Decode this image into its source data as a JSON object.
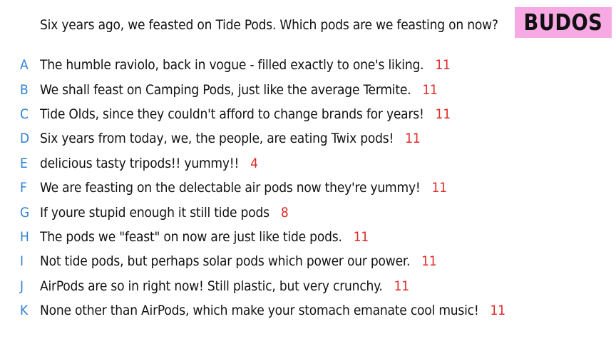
{
  "header": {
    "prompt": "Six years ago, we feasted on Tide Pods. Which pods are we feasting on now?",
    "logo": "BUDOS"
  },
  "answers": [
    {
      "letter": "A",
      "text": "The humble raviolo, back in vogue - filled exactly to one's liking.",
      "score": "11"
    },
    {
      "letter": "B",
      "text": "We shall feast on Camping Pods, just like the average Termite.",
      "score": "11"
    },
    {
      "letter": "C",
      "text": "Tide Olds, since they couldn't afford to change brands for years!",
      "score": "11"
    },
    {
      "letter": "D",
      "text": "Six years from today, we, the people, are eating Twix pods!",
      "score": "11"
    },
    {
      "letter": "E",
      "text": "delicious tasty tripods!! yummy!!",
      "score": "4"
    },
    {
      "letter": "F",
      "text": "We are feasting on the delectable air pods now they're yummy!",
      "score": "11"
    },
    {
      "letter": "G",
      "text": "If youre stupid enough it still tide pods",
      "score": "8"
    },
    {
      "letter": "H",
      "text": "The pods we \"feast\" on now are just like tide pods.",
      "score": "11"
    },
    {
      "letter": "I",
      "text": "Not tide pods, but perhaps solar pods which power our power.",
      "score": "11"
    },
    {
      "letter": "J",
      "text": "AirPods are so in right now! Still plastic, but very crunchy.",
      "score": "11"
    },
    {
      "letter": "K",
      "text": "None other than AirPods, which make your stomach emanate cool music!",
      "score": "11"
    }
  ],
  "colors": {
    "letter": "#2f82d6",
    "score": "#e02a2a",
    "logo_bg": "#f7a9e4"
  }
}
